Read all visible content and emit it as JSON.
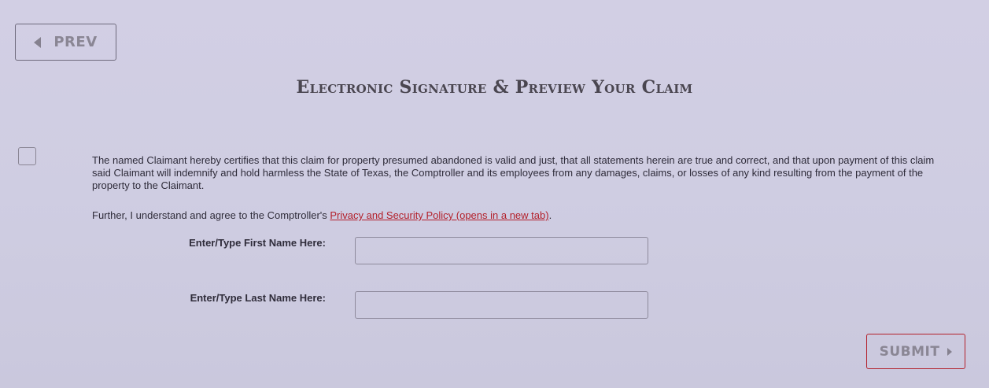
{
  "navigation": {
    "prev_label": "PREV"
  },
  "page": {
    "title": "Electronic Signature & Preview Your Claim"
  },
  "certification": {
    "text": "The named Claimant hereby certifies that this claim for property presumed abandoned is valid and just, that all statements herein are true and correct, and that upon payment of this claim said Claimant will indemnify and hold harmless the State of Texas, the Comptroller and its employees from any damages, claims, or losses of any kind resulting from the payment of the property to the Claimant.",
    "checked": false
  },
  "policy": {
    "prefix": "Further, I understand and agree to the Comptroller's ",
    "link_text": "Privacy and Security Policy (opens in a new tab)",
    "suffix": "."
  },
  "form": {
    "first_name_label": "Enter/Type First Name Here:",
    "first_name_value": "",
    "last_name_label": "Enter/Type Last Name Here:",
    "last_name_value": ""
  },
  "actions": {
    "submit_label": "SUBMIT"
  },
  "colors": {
    "accent_red": "#b3202b",
    "background": "#cfcde2",
    "muted_text": "#8a8694"
  },
  "icons": {
    "prev": "caret-left-icon",
    "submit": "caret-right-icon"
  }
}
